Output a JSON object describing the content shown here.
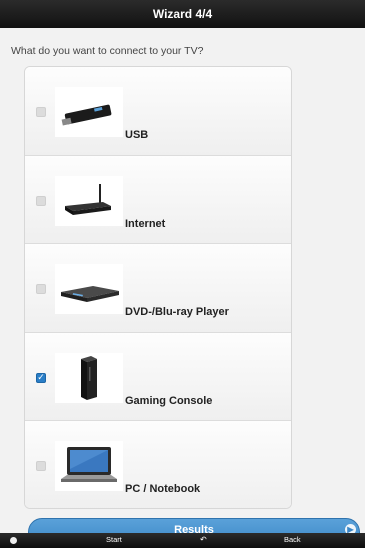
{
  "header": {
    "title": "Wizard 4/4"
  },
  "question": "What do you want to connect to your TV?",
  "options": [
    {
      "label": "USB",
      "checked": false,
      "icon": "usb-stick-icon"
    },
    {
      "label": "Internet",
      "checked": false,
      "icon": "router-icon"
    },
    {
      "label": "DVD-/Blu-ray Player",
      "checked": false,
      "icon": "bluray-player-icon"
    },
    {
      "label": "Gaming Console",
      "checked": true,
      "icon": "gaming-console-icon"
    },
    {
      "label": "PC / Notebook",
      "checked": false,
      "icon": "notebook-icon"
    }
  ],
  "results_button": {
    "label": "Results"
  },
  "footer": {
    "start_label": "Start",
    "back_label": "Back"
  },
  "colors": {
    "accent": "#3b86c6",
    "bar": "#1a1a1a",
    "checked": "#2a7ec7"
  }
}
